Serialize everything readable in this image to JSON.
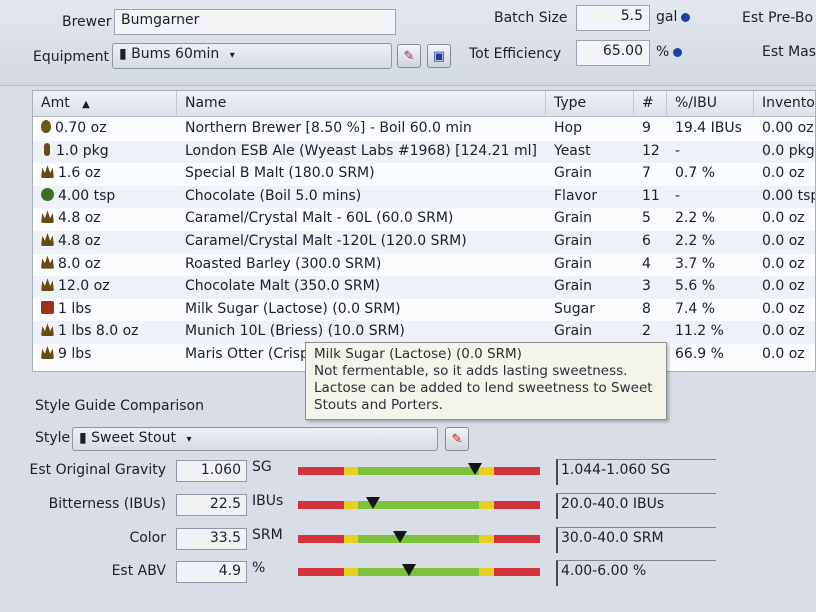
{
  "header": {
    "brewer_label": "Brewer",
    "brewer_value": "Bumgarner",
    "equipment_label": "Equipment",
    "equipment_value": "Bums 60min",
    "batch_size_label": "Batch Size",
    "batch_size_value": "5.5",
    "batch_size_unit": "gal",
    "tot_eff_label": "Tot Efficiency",
    "tot_eff_value": "65.00",
    "tot_eff_unit": "%",
    "est_preboil_label": "Est Pre-Bo",
    "est_mash_label": "Est Mas"
  },
  "table": {
    "columns": [
      "Amt",
      "Name",
      "Type",
      "#",
      "%/IBU",
      "Invento"
    ],
    "rows": [
      {
        "icon": "hop",
        "amt": "0.70 oz",
        "name": "Northern Brewer [8.50 %] - Boil 60.0 min",
        "type": "Hop",
        "num": "9",
        "pct": "19.4 IBUs",
        "inv": "0.00 oz"
      },
      {
        "icon": "yeast",
        "amt": "1.0 pkg",
        "name": "London ESB Ale (Wyeast Labs #1968) [124.21 ml]",
        "type": "Yeast",
        "num": "12",
        "pct": "-",
        "inv": "0.0 pkg"
      },
      {
        "icon": "grain",
        "amt": "1.6 oz",
        "name": "Special B Malt (180.0 SRM)",
        "type": "Grain",
        "num": "7",
        "pct": "0.7 %",
        "inv": "0.0 oz"
      },
      {
        "icon": "flavor",
        "amt": "4.00 tsp",
        "name": "Chocolate (Boil 5.0 mins)",
        "type": "Flavor",
        "num": "11",
        "pct": "-",
        "inv": "0.00 tsp"
      },
      {
        "icon": "grain",
        "amt": "4.8 oz",
        "name": "Caramel/Crystal Malt - 60L (60.0 SRM)",
        "type": "Grain",
        "num": "5",
        "pct": "2.2 %",
        "inv": "0.0 oz"
      },
      {
        "icon": "grain",
        "amt": "4.8 oz",
        "name": "Caramel/Crystal Malt -120L (120.0 SRM)",
        "type": "Grain",
        "num": "6",
        "pct": "2.2 %",
        "inv": "0.0 oz"
      },
      {
        "icon": "grain",
        "amt": "8.0 oz",
        "name": "Roasted Barley (300.0 SRM)",
        "type": "Grain",
        "num": "4",
        "pct": "3.7 %",
        "inv": "0.0 oz"
      },
      {
        "icon": "grain",
        "amt": "12.0 oz",
        "name": "Chocolate Malt (350.0 SRM)",
        "type": "Grain",
        "num": "3",
        "pct": "5.6 %",
        "inv": "0.0 oz"
      },
      {
        "icon": "sugar",
        "amt": "1 lbs",
        "name": "Milk Sugar (Lactose) (0.0 SRM)",
        "type": "Sugar",
        "num": "8",
        "pct": "7.4 %",
        "inv": "0.0 oz"
      },
      {
        "icon": "grain",
        "amt": "1 lbs 8.0 oz",
        "name": "Munich 10L (Briess) (10.0 SRM)",
        "type": "Grain",
        "num": "2",
        "pct": "11.2 %",
        "inv": "0.0 oz"
      },
      {
        "icon": "grain",
        "amt": "9 lbs",
        "name": "Maris Otter (Crisp",
        "type": "",
        "num": "",
        "pct": "66.9 %",
        "inv": "0.0 oz"
      }
    ]
  },
  "tooltip": {
    "title": "Milk Sugar (Lactose) (0.0 SRM)",
    "line1": "Not fermentable, so it adds lasting sweetness.",
    "line2": "Lactose can be added to lend  sweetness to Sweet",
    "line3": "Stouts and Porters."
  },
  "style_guide": {
    "title": "Style Guide Comparison",
    "style_label": "Style",
    "style_value": "Sweet Stout",
    "rows": [
      {
        "label": "Est Original Gravity",
        "value": "1.060",
        "unit": "SG",
        "range": "1.044-1.060 SG",
        "marker": 0.73
      },
      {
        "label": "Bitterness (IBUs)",
        "value": "22.5",
        "unit": "IBUs",
        "range": "20.0-40.0 IBUs",
        "marker": 0.31
      },
      {
        "label": "Color",
        "value": "33.5",
        "unit": "SRM",
        "range": "30.0-40.0 SRM",
        "marker": 0.42
      },
      {
        "label": "Est ABV",
        "value": "4.9",
        "unit": "%",
        "range": "4.00-6.00 %",
        "marker": 0.46
      }
    ]
  },
  "colors": {
    "accent": "#1d3fa8",
    "bar_red": "#d4333e",
    "bar_yellow": "#e8cf22",
    "bar_green": "#7cc23c"
  }
}
